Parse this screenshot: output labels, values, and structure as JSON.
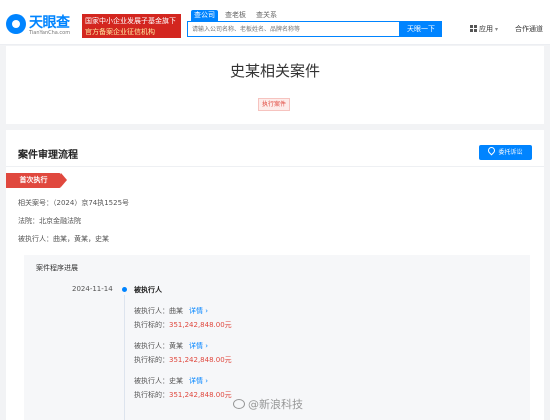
{
  "header": {
    "logo_name": "天眼查",
    "logo_url": "TianYanCha.com",
    "banner_line1": "国家中小企业发展子基金旗下",
    "banner_line2": "官方备案企业征信机构",
    "search_tabs": [
      "查公司",
      "查老板",
      "查关系"
    ],
    "search_placeholder": "请输入公司名称、老板姓名、品牌名称等",
    "search_button": "天眼一下",
    "app_label": "应用",
    "coop_label": "合作通道"
  },
  "page": {
    "title": "史某相关案件",
    "case_type_tag": "执行案件"
  },
  "section": {
    "title": "案件审理流程",
    "lawsuit_button": "委托诉讼",
    "stage_label": "首次执行",
    "case_no": "相关案号：（2024）京74执1525号",
    "court": "法院：北京金融法院",
    "executed_persons": "被执行人：曲某，黄某，史某"
  },
  "progress": {
    "title": "案件程序进展",
    "date": "2024-11-14",
    "event": "被执行人",
    "detail_link": "详情",
    "entries": [
      {
        "person": "被执行人：曲某",
        "amount_label": "执行标的：",
        "amount": "351,242,848.00元"
      },
      {
        "person": "被执行人：黄某",
        "amount_label": "执行标的：",
        "amount": "351,242,848.00元"
      },
      {
        "person": "被执行人：史某",
        "amount_label": "执行标的：",
        "amount": "351,242,848.00元"
      }
    ]
  },
  "watermark": "@新浪科技",
  "colors": {
    "brand": "#0084ff",
    "accent_red": "#e0483e",
    "banner_red": "#d3261f"
  },
  "icons": [
    "tianyancha-logo-icon",
    "grid-apps-icon",
    "chevron-down-icon",
    "location-pin-icon",
    "timeline-dot-icon",
    "chevron-right-icon",
    "weibo-icon"
  ]
}
